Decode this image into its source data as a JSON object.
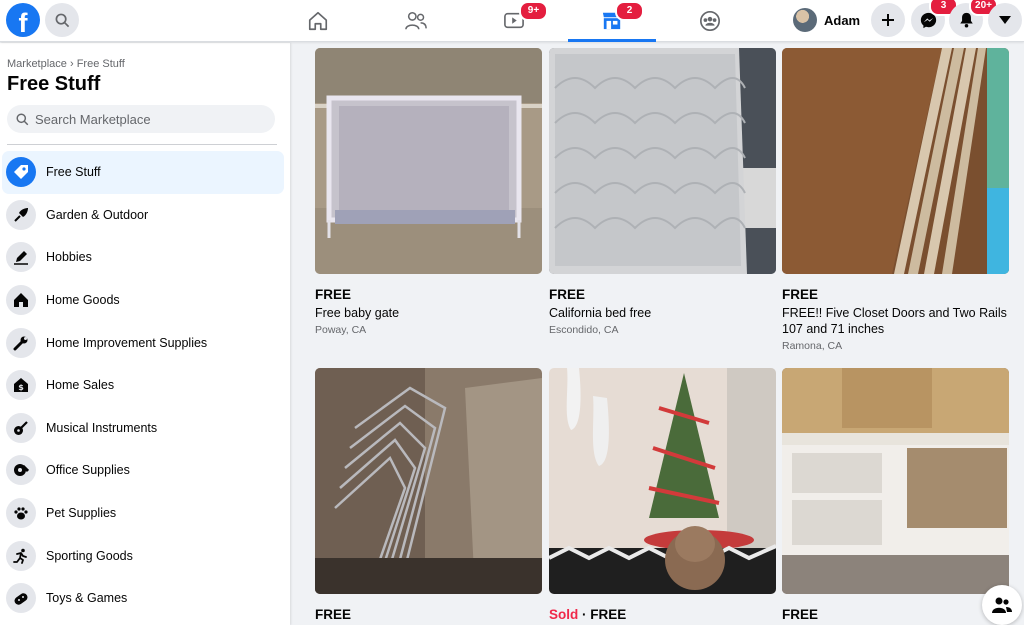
{
  "topbar": {
    "logo_letter": "f",
    "tabs": [
      {
        "name": "home-icon"
      },
      {
        "name": "friends-icon"
      },
      {
        "name": "watch-icon",
        "badge": "9+"
      },
      {
        "name": "marketplace-icon",
        "badge": "2",
        "active": true
      },
      {
        "name": "groups-icon"
      }
    ],
    "profile_name": "Adam",
    "messenger_badge": "3",
    "notifications_badge": "20+"
  },
  "sidebar": {
    "breadcrumb": "Marketplace › Free Stuff",
    "title": "Free Stuff",
    "search_placeholder": "Search Marketplace",
    "categories": [
      {
        "label": "Free Stuff",
        "icon": "free-stuff-icon",
        "active": true
      },
      {
        "label": "Garden & Outdoor",
        "icon": "garden-icon"
      },
      {
        "label": "Hobbies",
        "icon": "hobbies-icon"
      },
      {
        "label": "Home Goods",
        "icon": "home-goods-icon"
      },
      {
        "label": "Home Improvement Supplies",
        "icon": "wrench-icon"
      },
      {
        "label": "Home Sales",
        "icon": "home-sales-icon"
      },
      {
        "label": "Musical Instruments",
        "icon": "guitar-icon"
      },
      {
        "label": "Office Supplies",
        "icon": "office-icon"
      },
      {
        "label": "Pet Supplies",
        "icon": "paw-icon"
      },
      {
        "label": "Sporting Goods",
        "icon": "running-icon"
      },
      {
        "label": "Toys & Games",
        "icon": "gamepad-icon"
      }
    ]
  },
  "listings": [
    {
      "price": "FREE",
      "title": "Free baby gate",
      "location": "Poway, CA"
    },
    {
      "price": "FREE",
      "title": "California bed free",
      "location": "Escondido, CA"
    },
    {
      "price": "FREE",
      "title": "FREE!! Five Closet Doors and Two Rails 107 and 71 inches",
      "location": "Ramona, CA"
    },
    {
      "price": "FREE",
      "title": "",
      "location": ""
    },
    {
      "sold": "Sold",
      "sep": " · ",
      "price": "FREE",
      "title": "",
      "location": ""
    },
    {
      "price": "FREE",
      "title": "",
      "location": ""
    }
  ],
  "colors": {
    "accent": "#1877f2",
    "badge": "#e41e3f",
    "sold": "#f02849"
  }
}
